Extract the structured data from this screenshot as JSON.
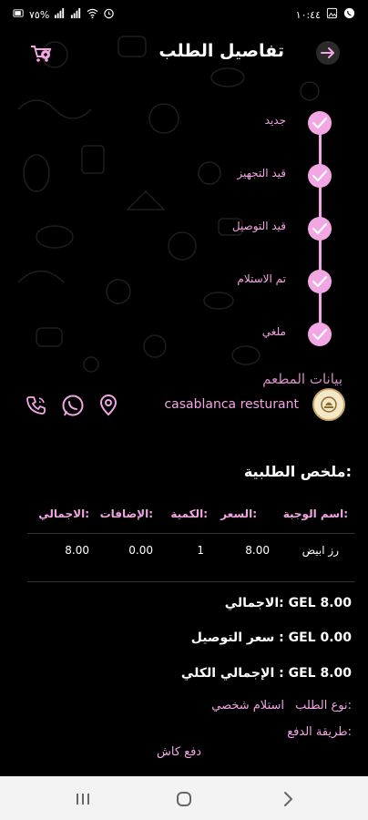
{
  "status_bar": {
    "time": "١٠:٤٤",
    "battery_percent": "٧٥%",
    "icons": [
      "whatsapp-icon",
      "gallery-icon",
      "alarm-icon",
      "wifi-icon",
      "signal-icon",
      "signal-icon",
      "battery-icon"
    ]
  },
  "header": {
    "title": "تفاصيل الطلب",
    "back_icon": "arrow-right-icon",
    "cart_icon": "cart-icon"
  },
  "timeline": {
    "steps": [
      {
        "label": "جديد"
      },
      {
        "label": "قيد التجهيز"
      },
      {
        "label": "قيد التوصيل"
      },
      {
        "label": "تم الاستلام"
      },
      {
        "label": "ملغي"
      }
    ]
  },
  "restaurant": {
    "section_label": "بيانات المطعم",
    "name": "casablanca resturant",
    "actions": [
      "phone-icon",
      "whatsapp-icon",
      "location-icon"
    ]
  },
  "summary": {
    "title": "ملخص الطلبية:",
    "headers": {
      "meal": "اسم الوجبة:",
      "price": "السعر:",
      "qty": "الكمية:",
      "addons": "الإضافات:",
      "total": "الاجمالي:"
    },
    "rows": [
      {
        "meal": "رز ابيض",
        "price": "8.00",
        "qty": "1",
        "addons": "0.00",
        "total": "8.00"
      }
    ],
    "subtotal": "الاجمالي: GEL 8.00",
    "delivery": "سعر التوصيل : GEL 0.00",
    "grand_total": "الإجمالي الكلي : GEL 8.00",
    "order_type_label": "نوع الطلب:",
    "order_type_value": "استلام شخصي",
    "payment_label": "طريقة الدفع:",
    "payment_value": "دفع كاش"
  },
  "colors": {
    "accent": "#f2a6e3",
    "background": "#000000"
  }
}
